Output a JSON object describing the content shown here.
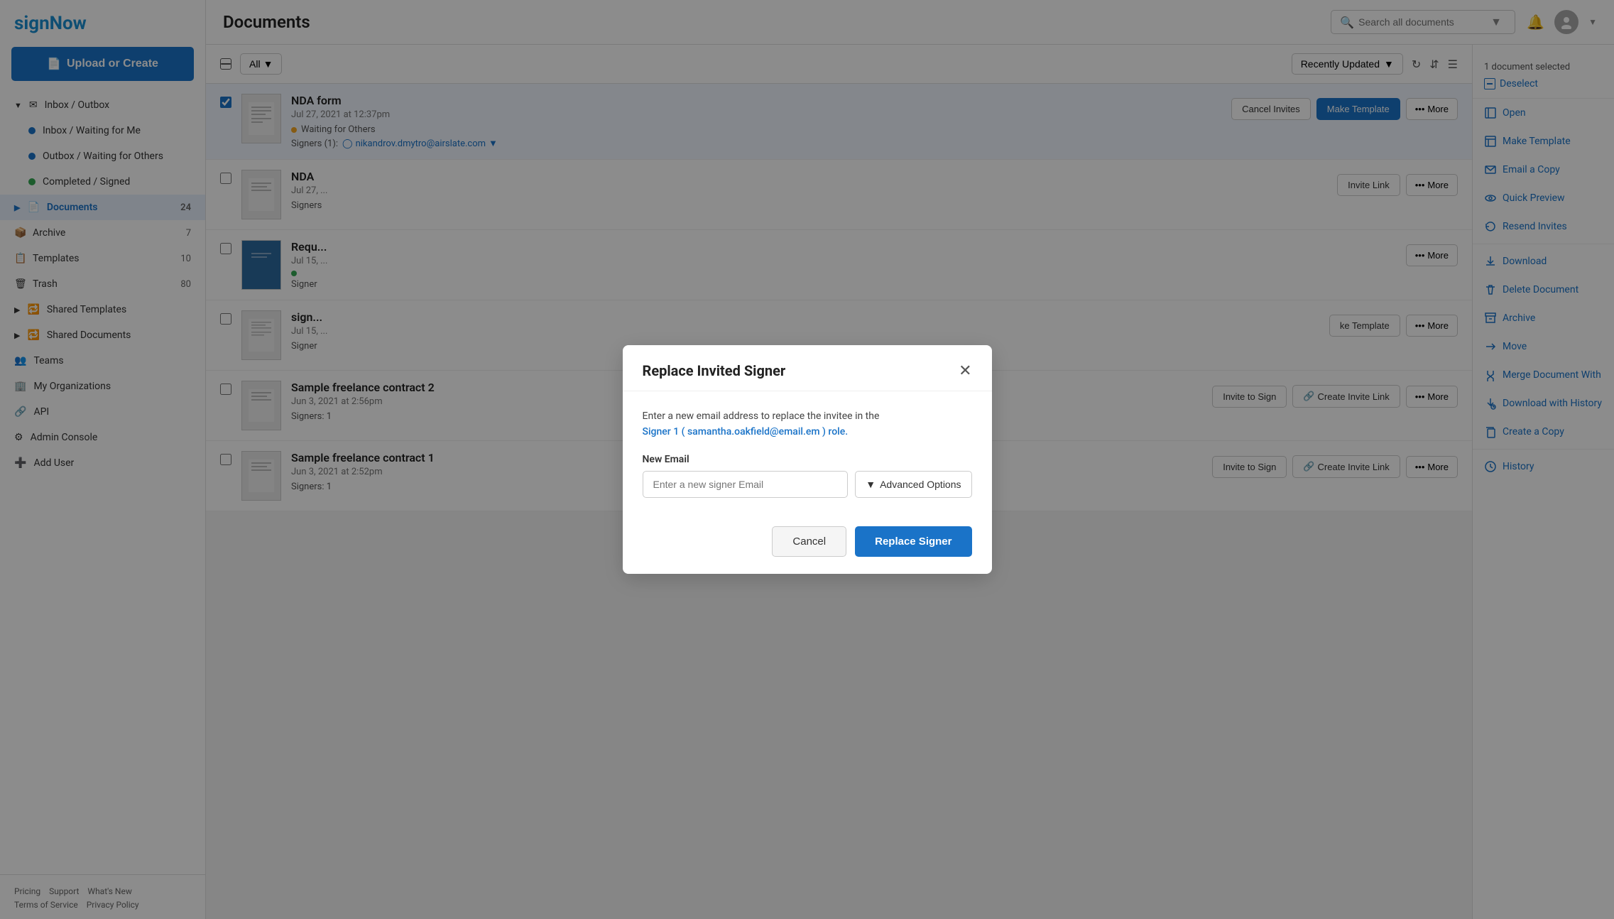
{
  "sidebar": {
    "logo": "signNow",
    "upload_btn": "Upload or Create",
    "nav": [
      {
        "id": "inbox-outbox",
        "label": "Inbox / Outbox",
        "icon": "inbox",
        "expandable": true,
        "badge": ""
      },
      {
        "id": "inbox-waiting",
        "label": "Inbox / Waiting for Me",
        "sub": true,
        "dot": "blue"
      },
      {
        "id": "outbox-waiting",
        "label": "Outbox / Waiting for Others",
        "sub": true,
        "dot": "blue"
      },
      {
        "id": "completed",
        "label": "Completed / Signed",
        "sub": true,
        "dot": "green"
      },
      {
        "id": "documents",
        "label": "Documents",
        "icon": "doc",
        "badge": "24",
        "active": true,
        "expandable": true
      },
      {
        "id": "archive",
        "label": "Archive",
        "icon": "archive",
        "badge": "7"
      },
      {
        "id": "templates",
        "label": "Templates",
        "icon": "template",
        "badge": "10"
      },
      {
        "id": "trash",
        "label": "Trash",
        "icon": "trash",
        "badge": "80"
      },
      {
        "id": "shared-templates",
        "label": "Shared Templates",
        "icon": "share",
        "expandable": true
      },
      {
        "id": "shared-documents",
        "label": "Shared Documents",
        "icon": "share2",
        "expandable": true
      },
      {
        "id": "teams",
        "label": "Teams",
        "icon": "teams"
      },
      {
        "id": "my-organizations",
        "label": "My Organizations",
        "icon": "org"
      },
      {
        "id": "api",
        "label": "API",
        "icon": "api"
      },
      {
        "id": "admin-console",
        "label": "Admin Console",
        "icon": "admin"
      },
      {
        "id": "add-user",
        "label": "Add User",
        "icon": "add-user"
      }
    ],
    "footer_links": [
      "Pricing",
      "Support",
      "What's New",
      "Terms of Service",
      "Privacy Policy"
    ]
  },
  "header": {
    "title": "Documents",
    "search_placeholder": "Search all documents",
    "search_icon": "search"
  },
  "toolbar": {
    "filter_label": "All",
    "sort_label": "Recently Updated"
  },
  "docs": [
    {
      "id": "doc1",
      "name": "NDA form",
      "date": "Jul 27, 2021 at 12:37pm",
      "status": "Waiting for Others",
      "status_type": "waiting",
      "signers_label": "Signers (1):",
      "signer_email": "nikandrov.dmytro@airslate.com",
      "selected": true,
      "actions": [
        {
          "id": "cancel-invites",
          "label": "Cancel Invites",
          "primary": false
        },
        {
          "id": "make-template",
          "label": "Make Template",
          "primary": true
        },
        {
          "id": "more",
          "label": "More",
          "type": "more"
        }
      ]
    },
    {
      "id": "doc2",
      "name": "NDA",
      "date": "Jul 27, ...",
      "status": "",
      "signers_label": "Signer",
      "selected": false,
      "actions": [
        {
          "id": "invite-link",
          "label": "Invite Link",
          "primary": false
        },
        {
          "id": "more",
          "label": "More",
          "type": "more"
        }
      ]
    },
    {
      "id": "doc3",
      "name": "Requ...",
      "date": "Jul 15, ...",
      "status": "green",
      "signers_label": "Signer",
      "selected": false,
      "actions": [
        {
          "id": "more",
          "label": "More",
          "type": "more"
        }
      ]
    },
    {
      "id": "doc4",
      "name": "sign...",
      "date": "Jul 15, ...",
      "status": "",
      "signers_label": "Signer",
      "selected": false,
      "actions": [
        {
          "id": "make-template",
          "label": "ke Template",
          "primary": false
        },
        {
          "id": "more",
          "label": "More",
          "type": "more"
        }
      ]
    },
    {
      "id": "doc5",
      "name": "Sample freelance contract 2",
      "date": "Jun 3, 2021 at 2:56pm",
      "status": "",
      "signers_label": "Signers: 1",
      "selected": false,
      "actions": [
        {
          "id": "invite-to-sign",
          "label": "Invite to Sign",
          "primary": false
        },
        {
          "id": "create-invite-link",
          "label": "Create Invite Link",
          "primary": false
        },
        {
          "id": "more",
          "label": "More",
          "type": "more"
        }
      ]
    },
    {
      "id": "doc6",
      "name": "Sample freelance contract 1",
      "date": "Jun 3, 2021 at 2:52pm",
      "status": "",
      "signers_label": "Signers: 1",
      "selected": false,
      "actions": [
        {
          "id": "invite-to-sign",
          "label": "Invite to Sign",
          "primary": false
        },
        {
          "id": "create-invite-link",
          "label": "Create Invite Link",
          "primary": false
        },
        {
          "id": "more",
          "label": "More",
          "type": "more"
        }
      ]
    }
  ],
  "right_panel": {
    "status": "1 document selected",
    "deselect": "Deselect",
    "actions": [
      {
        "id": "open",
        "label": "Open",
        "icon": "doc"
      },
      {
        "id": "make-template",
        "label": "Make Template",
        "icon": "template"
      },
      {
        "id": "email-copy",
        "label": "Email a Copy",
        "icon": "email"
      },
      {
        "id": "quick-preview",
        "label": "Quick Preview",
        "icon": "eye"
      },
      {
        "id": "resend-invites",
        "label": "Resend Invites",
        "icon": "resend"
      },
      {
        "id": "download",
        "label": "Download",
        "icon": "download"
      },
      {
        "id": "delete-document",
        "label": "Delete Document",
        "icon": "delete"
      },
      {
        "id": "archive",
        "label": "Archive",
        "icon": "archive"
      },
      {
        "id": "move",
        "label": "Move",
        "icon": "move"
      },
      {
        "id": "merge-document-with",
        "label": "Merge Document With",
        "icon": "merge"
      },
      {
        "id": "download-with-history",
        "label": "Download with History",
        "icon": "download-history"
      },
      {
        "id": "create-a-copy",
        "label": "Create a Copy",
        "icon": "copy"
      },
      {
        "id": "history",
        "label": "History",
        "icon": "history"
      }
    ]
  },
  "modal": {
    "title": "Replace Invited Signer",
    "description_prefix": "Enter a new email address to replace the invitee in the",
    "description_role": "Signer 1 ( samantha.oakfield@email.em ) role.",
    "field_label": "New Email",
    "email_placeholder": "Enter a new signer Email",
    "adv_options_label": "Advanced Options",
    "cancel_label": "Cancel",
    "confirm_label": "Replace Signer"
  }
}
